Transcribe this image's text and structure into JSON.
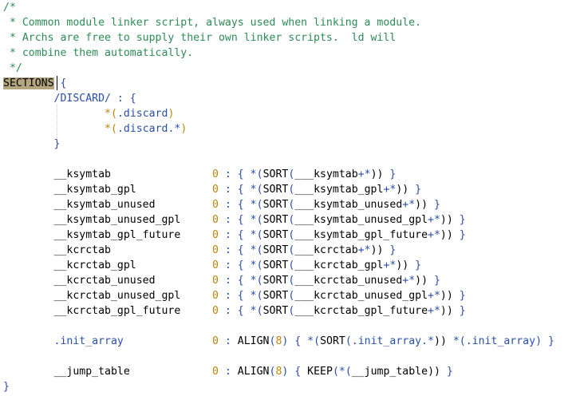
{
  "editor": {
    "lines": [
      {
        "tokens": [
          {
            "t": "/*",
            "c": "c-comment"
          }
        ]
      },
      {
        "tokens": [
          {
            "t": " * Common module linker script, always used when linking a module.",
            "c": "c-comment"
          }
        ]
      },
      {
        "tokens": [
          {
            "t": " * Archs are free to supply their own linker scripts.  ld will",
            "c": "c-comment"
          }
        ]
      },
      {
        "tokens": [
          {
            "t": " * combine them automatically.",
            "c": "c-comment"
          }
        ]
      },
      {
        "tokens": [
          {
            "t": " */",
            "c": "c-comment"
          }
        ]
      },
      {
        "tokens": [
          {
            "t": "SECTIONS",
            "c": "c-kw c-kw-hl"
          },
          {
            "t": " ",
            "c": ""
          },
          {
            "t": "{",
            "c": "c-brace"
          }
        ]
      },
      {
        "tokens": [
          {
            "t": "        /DISCARD/ : {",
            "c": "c-section"
          }
        ]
      },
      {
        "tokens": [
          {
            "t": "                ",
            "c": ""
          },
          {
            "t": "*(",
            "c": "c-str"
          },
          {
            "t": ".discard",
            "c": "c-dot"
          },
          {
            "t": ")",
            "c": "c-str"
          }
        ]
      },
      {
        "tokens": [
          {
            "t": "                ",
            "c": ""
          },
          {
            "t": "*(",
            "c": "c-str"
          },
          {
            "t": ".discard.*",
            "c": "c-dot"
          },
          {
            "t": ")",
            "c": "c-str"
          }
        ]
      },
      {
        "tokens": [
          {
            "t": "        }",
            "c": "c-section"
          }
        ]
      },
      {
        "tokens": [
          {
            "t": "",
            "c": ""
          }
        ]
      },
      {
        "tokens": [
          {
            "t": "        __ksymtab                ",
            "c": "c-sym"
          },
          {
            "t": "0",
            "c": "c-num"
          },
          {
            "t": " : { ",
            "c": "c-op"
          },
          {
            "t": "*(",
            "c": "c-op"
          },
          {
            "t": "SORT",
            "c": "c-fn"
          },
          {
            "t": "(",
            "c": "c-op"
          },
          {
            "t": "___ksymtab",
            "c": "c-sym"
          },
          {
            "t": "+*",
            "c": "c-plus"
          },
          {
            "t": "))",
            "c": "c-paren"
          },
          {
            "t": " }",
            "c": "c-op"
          }
        ]
      },
      {
        "tokens": [
          {
            "t": "        __ksymtab_gpl            ",
            "c": "c-sym"
          },
          {
            "t": "0",
            "c": "c-num"
          },
          {
            "t": " : { ",
            "c": "c-op"
          },
          {
            "t": "*(",
            "c": "c-op"
          },
          {
            "t": "SORT",
            "c": "c-fn"
          },
          {
            "t": "(",
            "c": "c-op"
          },
          {
            "t": "___ksymtab_gpl",
            "c": "c-sym"
          },
          {
            "t": "+*",
            "c": "c-plus"
          },
          {
            "t": "))",
            "c": "c-paren"
          },
          {
            "t": " }",
            "c": "c-op"
          }
        ]
      },
      {
        "tokens": [
          {
            "t": "        __ksymtab_unused         ",
            "c": "c-sym"
          },
          {
            "t": "0",
            "c": "c-num"
          },
          {
            "t": " : { ",
            "c": "c-op"
          },
          {
            "t": "*(",
            "c": "c-op"
          },
          {
            "t": "SORT",
            "c": "c-fn"
          },
          {
            "t": "(",
            "c": "c-op"
          },
          {
            "t": "___ksymtab_unused",
            "c": "c-sym"
          },
          {
            "t": "+*",
            "c": "c-plus"
          },
          {
            "t": "))",
            "c": "c-paren"
          },
          {
            "t": " }",
            "c": "c-op"
          }
        ]
      },
      {
        "tokens": [
          {
            "t": "        __ksymtab_unused_gpl     ",
            "c": "c-sym"
          },
          {
            "t": "0",
            "c": "c-num"
          },
          {
            "t": " : { ",
            "c": "c-op"
          },
          {
            "t": "*(",
            "c": "c-op"
          },
          {
            "t": "SORT",
            "c": "c-fn"
          },
          {
            "t": "(",
            "c": "c-op"
          },
          {
            "t": "___ksymtab_unused_gpl",
            "c": "c-sym"
          },
          {
            "t": "+*",
            "c": "c-plus"
          },
          {
            "t": "))",
            "c": "c-paren"
          },
          {
            "t": " }",
            "c": "c-op"
          }
        ]
      },
      {
        "tokens": [
          {
            "t": "        __ksymtab_gpl_future     ",
            "c": "c-sym"
          },
          {
            "t": "0",
            "c": "c-num"
          },
          {
            "t": " : { ",
            "c": "c-op"
          },
          {
            "t": "*(",
            "c": "c-op"
          },
          {
            "t": "SORT",
            "c": "c-fn"
          },
          {
            "t": "(",
            "c": "c-op"
          },
          {
            "t": "___ksymtab_gpl_future",
            "c": "c-sym"
          },
          {
            "t": "+*",
            "c": "c-plus"
          },
          {
            "t": "))",
            "c": "c-paren"
          },
          {
            "t": " }",
            "c": "c-op"
          }
        ]
      },
      {
        "tokens": [
          {
            "t": "        __kcrctab                ",
            "c": "c-sym"
          },
          {
            "t": "0",
            "c": "c-num"
          },
          {
            "t": " : { ",
            "c": "c-op"
          },
          {
            "t": "*(",
            "c": "c-op"
          },
          {
            "t": "SORT",
            "c": "c-fn"
          },
          {
            "t": "(",
            "c": "c-op"
          },
          {
            "t": "___kcrctab",
            "c": "c-sym"
          },
          {
            "t": "+*",
            "c": "c-plus"
          },
          {
            "t": "))",
            "c": "c-paren"
          },
          {
            "t": " }",
            "c": "c-op"
          }
        ]
      },
      {
        "tokens": [
          {
            "t": "        __kcrctab_gpl            ",
            "c": "c-sym"
          },
          {
            "t": "0",
            "c": "c-num"
          },
          {
            "t": " : { ",
            "c": "c-op"
          },
          {
            "t": "*(",
            "c": "c-op"
          },
          {
            "t": "SORT",
            "c": "c-fn"
          },
          {
            "t": "(",
            "c": "c-op"
          },
          {
            "t": "___kcrctab_gpl",
            "c": "c-sym"
          },
          {
            "t": "+*",
            "c": "c-plus"
          },
          {
            "t": "))",
            "c": "c-paren"
          },
          {
            "t": " }",
            "c": "c-op"
          }
        ]
      },
      {
        "tokens": [
          {
            "t": "        __kcrctab_unused         ",
            "c": "c-sym"
          },
          {
            "t": "0",
            "c": "c-num"
          },
          {
            "t": " : { ",
            "c": "c-op"
          },
          {
            "t": "*(",
            "c": "c-op"
          },
          {
            "t": "SORT",
            "c": "c-fn"
          },
          {
            "t": "(",
            "c": "c-op"
          },
          {
            "t": "___kcrctab_unused",
            "c": "c-sym"
          },
          {
            "t": "+*",
            "c": "c-plus"
          },
          {
            "t": "))",
            "c": "c-paren"
          },
          {
            "t": " }",
            "c": "c-op"
          }
        ]
      },
      {
        "tokens": [
          {
            "t": "        __kcrctab_unused_gpl     ",
            "c": "c-sym"
          },
          {
            "t": "0",
            "c": "c-num"
          },
          {
            "t": " : { ",
            "c": "c-op"
          },
          {
            "t": "*(",
            "c": "c-op"
          },
          {
            "t": "SORT",
            "c": "c-fn"
          },
          {
            "t": "(",
            "c": "c-op"
          },
          {
            "t": "___kcrctab_unused_gpl",
            "c": "c-sym"
          },
          {
            "t": "+*",
            "c": "c-plus"
          },
          {
            "t": "))",
            "c": "c-paren"
          },
          {
            "t": " }",
            "c": "c-op"
          }
        ]
      },
      {
        "tokens": [
          {
            "t": "        __kcrctab_gpl_future     ",
            "c": "c-sym"
          },
          {
            "t": "0",
            "c": "c-num"
          },
          {
            "t": " : { ",
            "c": "c-op"
          },
          {
            "t": "*(",
            "c": "c-op"
          },
          {
            "t": "SORT",
            "c": "c-fn"
          },
          {
            "t": "(",
            "c": "c-op"
          },
          {
            "t": "___kcrctab_gpl_future",
            "c": "c-sym"
          },
          {
            "t": "+*",
            "c": "c-plus"
          },
          {
            "t": "))",
            "c": "c-paren"
          },
          {
            "t": " }",
            "c": "c-op"
          }
        ]
      },
      {
        "tokens": [
          {
            "t": "",
            "c": ""
          }
        ]
      },
      {
        "tokens": [
          {
            "t": "        .init_array              ",
            "c": "c-dot"
          },
          {
            "t": "0",
            "c": "c-num"
          },
          {
            "t": " : ",
            "c": "c-op"
          },
          {
            "t": "ALIGN",
            "c": "c-fn"
          },
          {
            "t": "(",
            "c": "c-op"
          },
          {
            "t": "8",
            "c": "c-num"
          },
          {
            "t": ") { ",
            "c": "c-op"
          },
          {
            "t": "*(",
            "c": "c-op"
          },
          {
            "t": "SORT",
            "c": "c-fn"
          },
          {
            "t": "(",
            "c": "c-op"
          },
          {
            "t": ".init_array.*",
            "c": "c-dot"
          },
          {
            "t": ")) ",
            "c": "c-paren"
          },
          {
            "t": "*(",
            "c": "c-op"
          },
          {
            "t": ".init_array",
            "c": "c-dot"
          },
          {
            "t": ") }",
            "c": "c-op"
          }
        ]
      },
      {
        "tokens": [
          {
            "t": "",
            "c": ""
          }
        ]
      },
      {
        "tokens": [
          {
            "t": "        __jump_table             ",
            "c": "c-sym"
          },
          {
            "t": "0",
            "c": "c-num"
          },
          {
            "t": " : ",
            "c": "c-op"
          },
          {
            "t": "ALIGN",
            "c": "c-fn"
          },
          {
            "t": "(",
            "c": "c-op"
          },
          {
            "t": "8",
            "c": "c-num"
          },
          {
            "t": ") { ",
            "c": "c-op"
          },
          {
            "t": "KEEP",
            "c": "c-fn"
          },
          {
            "t": "(",
            "c": "c-op"
          },
          {
            "t": "*(",
            "c": "c-op"
          },
          {
            "t": "__jump_table",
            "c": "c-sym"
          },
          {
            "t": "))",
            "c": "c-paren"
          },
          {
            "t": " }",
            "c": "c-op"
          }
        ]
      },
      {
        "tokens": [
          {
            "t": "}",
            "c": "c-brace"
          }
        ]
      }
    ]
  }
}
